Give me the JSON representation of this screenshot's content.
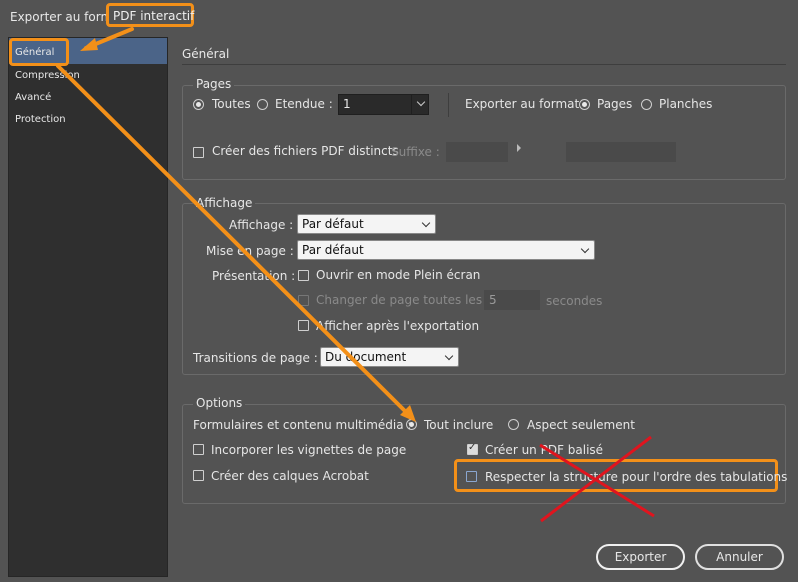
{
  "titlebar": {
    "title_prefix": "Exporter au format",
    "title_highlight": "PDF interactif"
  },
  "sidebar": {
    "items": [
      {
        "label": "Général",
        "selected": true
      },
      {
        "label": "Compression",
        "selected": false
      },
      {
        "label": "Avancé",
        "selected": false
      },
      {
        "label": "Protection",
        "selected": false
      }
    ]
  },
  "main": {
    "heading": "Général",
    "pages": {
      "legend": "Pages",
      "option_toutes": "Toutes",
      "option_etendue": "Etendue :",
      "range_value": "1",
      "export_as_label": "Exporter au format",
      "option_pages": "Pages",
      "option_planches": "Planches",
      "separate_pdf_label": "Créer des fichiers PDF distincts",
      "suffix_label": "Suffixe :"
    },
    "affichage": {
      "legend": "Affichage",
      "view_label": "Affichage :",
      "view_value": "Par défaut",
      "layout_label": "Mise en page :",
      "layout_value": "Par défaut",
      "presentation_label": "Présentation :",
      "fullscreen_label": "Ouvrir en mode Plein écran",
      "flip_label": "Changer de page toutes les :",
      "flip_value": "5",
      "seconds_label": "secondes",
      "view_after_label": "Afficher après l'exportation",
      "transitions_label": "Transitions de page :",
      "transitions_value": "Du document"
    },
    "options": {
      "legend": "Options",
      "forms_label": "Formulaires et contenu multimédia :",
      "include_all": "Tout inclure",
      "appearance_only": "Aspect seulement",
      "thumbnails_label": "Incorporer les vignettes de page",
      "tagged_pdf_label": "Créer un PDF balisé",
      "layers_label": "Créer des calques Acrobat",
      "tab_order_label": "Respecter la structure pour l'ordre des tabulations"
    },
    "buttons": {
      "export": "Exporter",
      "cancel": "Annuler"
    }
  },
  "colors": {
    "accent_orange": "#f39019",
    "annotation_red": "#e0141e",
    "selection_blue": "#4b6488",
    "dialog_bg": "#535353",
    "sidebar_bg": "#2f2f2f"
  }
}
